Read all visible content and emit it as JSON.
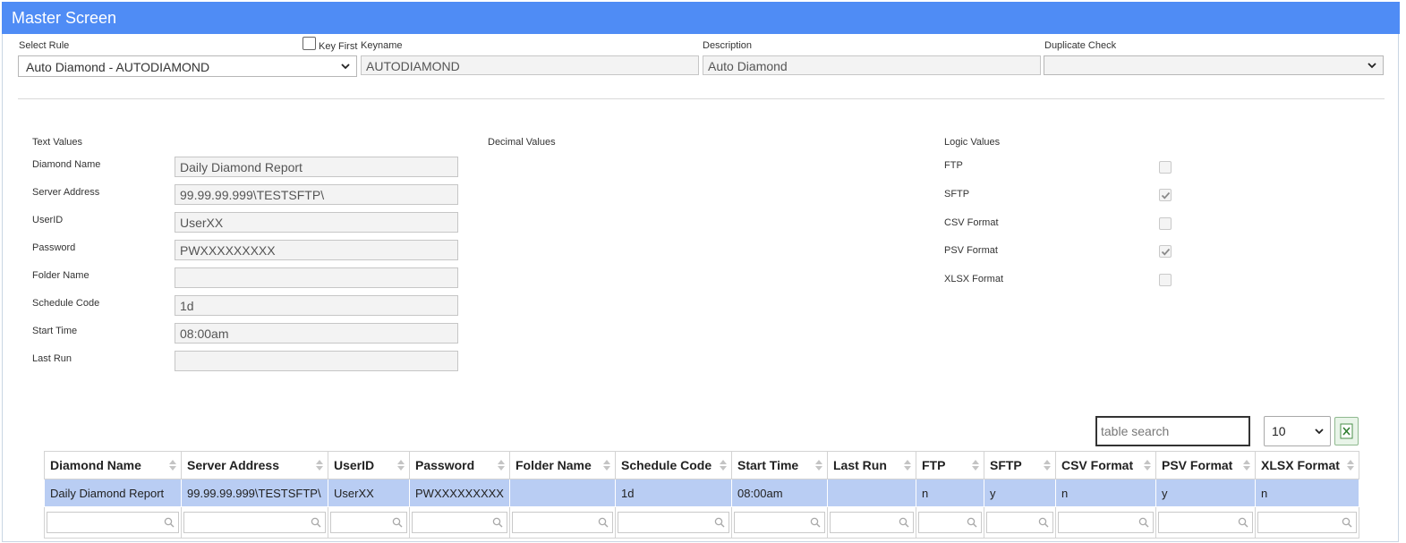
{
  "header": {
    "title": "Master Screen"
  },
  "top": {
    "select_rule_label": "Select Rule",
    "select_rule_value": "Auto Diamond - AUTODIAMOND",
    "key_first_label": "Key First",
    "keyname_label": "Keyname",
    "keyname_value": "AUTODIAMOND",
    "description_label": "Description",
    "description_value": "Auto Diamond",
    "duplicate_check_label": "Duplicate Check",
    "duplicate_check_value": ""
  },
  "sections": {
    "text_values": "Text Values",
    "decimal_values": "Decimal Values",
    "logic_values": "Logic Values"
  },
  "text_fields": [
    {
      "label": "Diamond Name",
      "value": "Daily Diamond Report"
    },
    {
      "label": "Server Address",
      "value": "99.99.99.999\\TESTSFTP\\"
    },
    {
      "label": "UserID",
      "value": "UserXX"
    },
    {
      "label": "Password",
      "value": "PWXXXXXXXXX"
    },
    {
      "label": "Folder Name",
      "value": ""
    },
    {
      "label": "Schedule Code",
      "value": "1d"
    },
    {
      "label": "Start Time",
      "value": "08:00am"
    },
    {
      "label": "Last Run",
      "value": ""
    }
  ],
  "logic_fields": [
    {
      "label": "FTP",
      "checked": false
    },
    {
      "label": "SFTP",
      "checked": true
    },
    {
      "label": "CSV Format",
      "checked": false
    },
    {
      "label": "PSV Format",
      "checked": true
    },
    {
      "label": "XLSX Format",
      "checked": false
    }
  ],
  "table": {
    "search_placeholder": "table search",
    "page_size": "10",
    "columns": [
      "Diamond Name",
      "Server Address",
      "UserID",
      "Password",
      "Folder Name",
      "Schedule Code",
      "Start Time",
      "Last Run",
      "FTP",
      "SFTP",
      "CSV Format",
      "PSV Format",
      "XLSX Format"
    ],
    "rows": [
      [
        "Daily Diamond Report",
        "99.99.99.999\\TESTSFTP\\",
        "UserXX",
        "PWXXXXXXXXX",
        "",
        "1d",
        "08:00am",
        "",
        "n",
        "y",
        "n",
        "y",
        "n"
      ]
    ]
  },
  "colors": {
    "header_bg": "#4f8cf5",
    "row_selected": "#b9cdf3"
  },
  "icons": {
    "sort": "sort-icon",
    "filter": "magnifier-icon",
    "excel": "excel-icon",
    "dropdown": "chevron-down-icon",
    "check": "check-icon"
  }
}
